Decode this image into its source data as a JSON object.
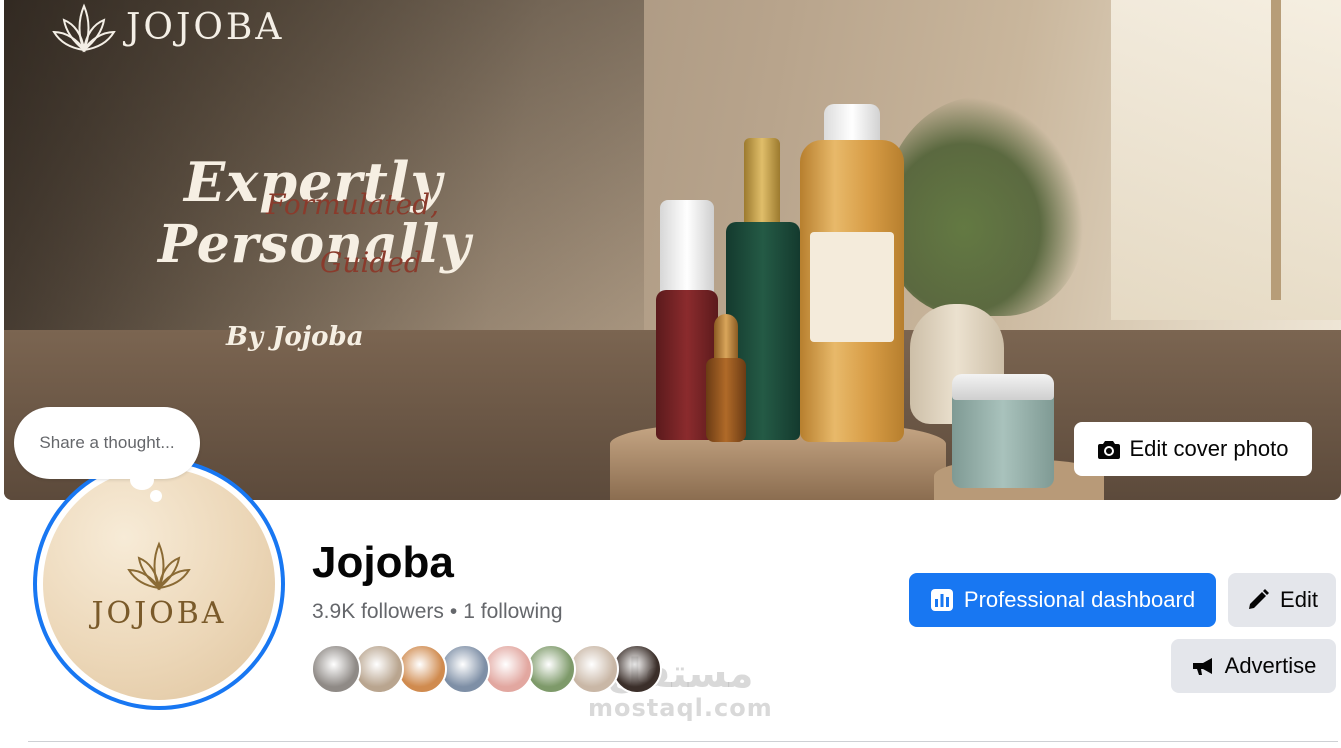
{
  "cover": {
    "brand_name": "JOJOBA",
    "headline_line1": "Expertly",
    "headline_script1": "Formulated,",
    "headline_line2": "Personally",
    "headline_script2": "Guided",
    "byline": "By Jojoba",
    "edit_cover_label": "Edit cover photo"
  },
  "thought_bubble": {
    "placeholder": "Share a thought..."
  },
  "profile": {
    "avatar_text": "JOJOBA",
    "page_name": "Jojoba",
    "followers": "3.9K followers",
    "separator": "•",
    "following": "1 following",
    "follower_faces": [
      {
        "color": "#8f8a86"
      },
      {
        "color": "#b9a58f"
      },
      {
        "color": "#d08b4f"
      },
      {
        "color": "#7e8fa6"
      },
      {
        "color": "#e2a7a0"
      },
      {
        "color": "#7e9a6a"
      },
      {
        "color": "#c9b7a6"
      },
      {
        "color": "#3b2f2a"
      }
    ]
  },
  "actions": {
    "professional_dashboard": "Professional dashboard",
    "edit": "Edit",
    "advertise": "Advertise"
  },
  "watermark": {
    "arabic": "مستقل",
    "latin": "mostaql.com"
  },
  "colors": {
    "accent": "#1877f2",
    "secondary_button": "#e4e6eb",
    "text_primary": "#050505",
    "text_secondary": "#65676b"
  }
}
